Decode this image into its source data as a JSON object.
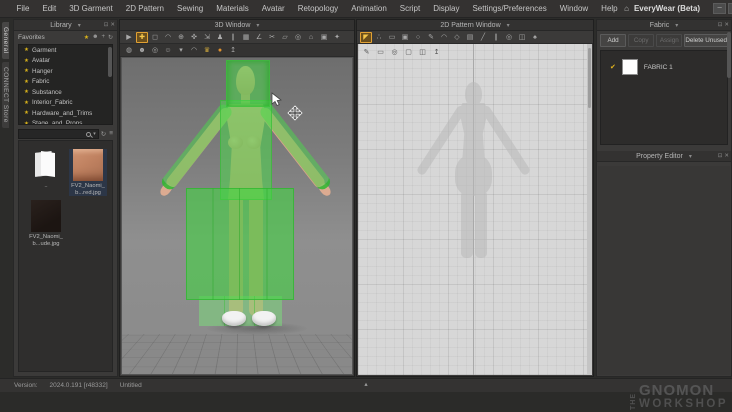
{
  "app": {
    "title": "EveryWear (Beta)",
    "menu": [
      "File",
      "Edit",
      "3D Garment",
      "2D Pattern",
      "Sewing",
      "Materials",
      "Avatar",
      "Retopology",
      "Animation",
      "Script",
      "Display",
      "Settings/Preferences",
      "Window",
      "Help"
    ],
    "window_controls": [
      {
        "name": "minimize-button",
        "glyph": "─"
      },
      {
        "name": "maximize-button",
        "glyph": "□"
      },
      {
        "name": "close-button",
        "glyph": "✕"
      }
    ],
    "app_icon_glyph": "⌂"
  },
  "panel_common": {
    "caret": "▾",
    "controls": [
      {
        "name": "float-panel-icon",
        "glyph": "⊡"
      },
      {
        "name": "close-panel-icon",
        "glyph": "✕"
      }
    ]
  },
  "side_tabs": [
    {
      "label": "General",
      "cls": "active"
    },
    {
      "label": "CONNECT Store",
      "cls": ""
    }
  ],
  "library": {
    "title": "Library",
    "favorites_label": "Favorites",
    "header_icons": [
      {
        "name": "favorite-star-icon",
        "glyph": "★",
        "cls": "gold"
      },
      {
        "name": "avatar-category-icon",
        "glyph": "☻",
        "cls": ""
      },
      {
        "name": "add-favorite-icon",
        "glyph": "+",
        "cls": ""
      },
      {
        "name": "sync-library-icon",
        "glyph": "↻",
        "cls": ""
      }
    ],
    "favorites": [
      "Garment",
      "Avatar",
      "Hanger",
      "Fabric",
      "Substance",
      "Interior_Fabric",
      "Hardware_and_Trims",
      "Stage_and_Props"
    ],
    "search": {
      "placeholder": "",
      "value": ""
    },
    "search_icons": [
      {
        "name": "refresh-icon",
        "glyph": "↻"
      },
      {
        "name": "list-view-icon",
        "glyph": "≡"
      }
    ],
    "items": [
      {
        "name": "folder-up-item",
        "cls": "folder",
        "line1": "..",
        "line2": ""
      },
      {
        "name": "texture-file-red",
        "cls": "img-skin selected",
        "line1": "FV2_Naomi_",
        "line2": "b...red.jpg"
      },
      {
        "name": "texture-file-nude",
        "cls": "img-dark",
        "line1": "FV2_Naomi_",
        "line2": "b...ude.jpg"
      }
    ]
  },
  "window3d": {
    "title": "3D Window",
    "tools": [
      {
        "name": "simulate-icon",
        "glyph": "▶",
        "cls": ""
      },
      {
        "name": "select-move-icon",
        "glyph": "✚",
        "cls": "active"
      },
      {
        "name": "select-mesh-box-icon",
        "glyph": "◻",
        "cls": ""
      },
      {
        "name": "select-lasso-icon",
        "glyph": "◠",
        "cls": ""
      },
      {
        "name": "pin-icon",
        "glyph": "⊕",
        "cls": ""
      },
      {
        "name": "move-gizmo-icon",
        "glyph": "✜",
        "cls": ""
      },
      {
        "name": "scale-gizmo-icon",
        "glyph": "⇲",
        "cls": ""
      },
      {
        "name": "tack-on-avatar-icon",
        "glyph": "♟",
        "cls": ""
      },
      {
        "name": "segment-sewing-icon",
        "glyph": "∥",
        "cls": ""
      },
      {
        "name": "free-sewing-icon",
        "glyph": "▦",
        "cls": ""
      },
      {
        "name": "measure-icon",
        "glyph": "∠",
        "cls": ""
      },
      {
        "name": "scissors-icon",
        "glyph": "✂",
        "cls": ""
      },
      {
        "name": "flatten-icon",
        "glyph": "▱",
        "cls": ""
      },
      {
        "name": "avatar-tape-icon",
        "glyph": "◎",
        "cls": ""
      },
      {
        "name": "arrangement-icon",
        "glyph": "⌂",
        "cls": ""
      },
      {
        "name": "camera-icon",
        "glyph": "▣",
        "cls": ""
      },
      {
        "name": "render-icon",
        "glyph": "✦",
        "cls": ""
      }
    ],
    "display_tools": [
      {
        "name": "show-garment-icon",
        "glyph": "◍",
        "cls": ""
      },
      {
        "name": "show-avatar-icon",
        "glyph": "☻",
        "cls": ""
      },
      {
        "name": "zoom-fit-icon",
        "glyph": "◎",
        "cls": ""
      },
      {
        "name": "show-mannequin-icon",
        "glyph": "☺",
        "cls": ""
      },
      {
        "name": "show-shoes-icon",
        "glyph": "▾",
        "cls": ""
      },
      {
        "name": "show-hair-icon",
        "glyph": "◠",
        "cls": ""
      },
      {
        "name": "show-accessories-icon",
        "glyph": "♛",
        "cls": "gold"
      },
      {
        "name": "avatar-display-mode-icon",
        "glyph": "●",
        "cls": "orange"
      },
      {
        "name": "arrangement-points-icon",
        "glyph": "↥",
        "cls": ""
      }
    ]
  },
  "window2d": {
    "title": "2D Pattern Window",
    "tools": [
      {
        "name": "transform-pattern-icon",
        "glyph": "◤",
        "cls": "active"
      },
      {
        "name": "edit-pattern-icon",
        "glyph": "∴",
        "cls": ""
      },
      {
        "name": "add-point-icon",
        "glyph": "▭",
        "cls": ""
      },
      {
        "name": "add-rectangle-icon",
        "glyph": "▣",
        "cls": ""
      },
      {
        "name": "add-circle-icon",
        "glyph": "○",
        "cls": ""
      },
      {
        "name": "polygon-pen-icon",
        "glyph": "✎",
        "cls": ""
      },
      {
        "name": "edit-curvature-icon",
        "glyph": "◠",
        "cls": ""
      },
      {
        "name": "dart-icon",
        "glyph": "◇",
        "cls": ""
      },
      {
        "name": "grading-icon",
        "glyph": "▤",
        "cls": ""
      },
      {
        "name": "notch-icon",
        "glyph": "╱",
        "cls": ""
      },
      {
        "name": "pleats-icon",
        "glyph": "∥",
        "cls": ""
      },
      {
        "name": "trace-icon",
        "glyph": "◎",
        "cls": ""
      },
      {
        "name": "texture-editor-icon",
        "glyph": "◫",
        "cls": ""
      },
      {
        "name": "garment-icon",
        "glyph": "♠",
        "cls": ""
      }
    ],
    "overlay_tools": [
      {
        "name": "needle-icon",
        "glyph": "✎"
      },
      {
        "name": "pattern-outline-icon",
        "glyph": "▭"
      },
      {
        "name": "magnifier-icon",
        "glyph": "◎"
      },
      {
        "name": "frame-icon",
        "glyph": "▢"
      },
      {
        "name": "split-view-icon",
        "glyph": "◫"
      },
      {
        "name": "reset-view-icon",
        "glyph": "↥"
      }
    ]
  },
  "fabric_panel": {
    "title": "Fabric",
    "buttons": [
      {
        "label": "Add",
        "cls": ""
      },
      {
        "label": "Copy",
        "cls": "disabled"
      },
      {
        "label": "Assign",
        "cls": "disabled"
      },
      {
        "label": "Delete Unused",
        "cls": "wide"
      }
    ],
    "items": [
      {
        "label": "FABRIC 1",
        "check": "✔"
      }
    ]
  },
  "property_editor": {
    "title": "Property Editor"
  },
  "statusbar": {
    "version_label": "Version:",
    "version": "2024.0.191 [r48332]",
    "filename": "Untitled",
    "expand_glyph": "▴"
  },
  "watermark": {
    "the": "THE",
    "gnomon": "GNOMON",
    "workshop": "WORKSHOP"
  },
  "colors": {
    "accent_orange": "#e0952f",
    "garment_green": "#4cd94c",
    "fabric_swatch": "#ffffff"
  }
}
